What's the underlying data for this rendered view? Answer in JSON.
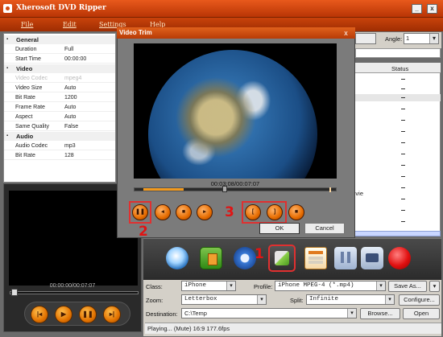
{
  "window": {
    "title": "Xherosoft DVD Ripper",
    "min_glyph": "_",
    "max_glyph": "□",
    "close_glyph": "x"
  },
  "menu": {
    "items": [
      "File",
      "Edit",
      "Settings",
      "Help"
    ]
  },
  "properties": {
    "sections": [
      {
        "name": "General",
        "rows": [
          [
            "Duration",
            "Full"
          ],
          [
            "Start Time",
            "00:00:00"
          ]
        ]
      },
      {
        "name": "Video",
        "rows": [
          [
            "Video Codec",
            "mpeg4"
          ],
          [
            "Video Size",
            "Auto"
          ],
          [
            "Bit Rate",
            "1200"
          ],
          [
            "Frame Rate",
            "Auto"
          ],
          [
            "Aspect",
            "Auto"
          ],
          [
            "Same Quality",
            "False"
          ]
        ]
      },
      {
        "name": "Audio",
        "rows": [
          [
            "Audio Codec",
            "mp3"
          ],
          [
            "Bit Rate",
            "128"
          ]
        ]
      }
    ]
  },
  "preview": {
    "time": "00:00:00/00:07:07",
    "buttons": [
      "prev",
      "play",
      "pause",
      "next"
    ]
  },
  "right_panel": {
    "angle_label": "Angle:",
    "angle_value": "1",
    "col_set": "et",
    "col_status": "Status",
    "row_text": "Movie"
  },
  "trim_dialog": {
    "title": "Video Trim",
    "close_glyph": "x",
    "time": "00:03:08/00:07:07",
    "ok": "OK",
    "cancel": "Cancel"
  },
  "annotations": {
    "one": "1",
    "two": "2",
    "three": "3"
  },
  "options": {
    "class_label": "Class:",
    "class_value": "iPhone",
    "profile_label": "Profile:",
    "profile_value": "iPhone MPEG-4  (*.mp4)",
    "save_as": "Save As...",
    "zoom_label": "Zoom:",
    "zoom_value": "Letterbox",
    "split_label": "Split:",
    "split_value": "Infinite",
    "configure": "Configure...",
    "destination_label": "Destination:",
    "destination_value": "C:\\Temp",
    "browse": "Browse...",
    "open": "Open"
  },
  "status": {
    "text": "Playing... (Mute) 16:9  177.6fps"
  }
}
